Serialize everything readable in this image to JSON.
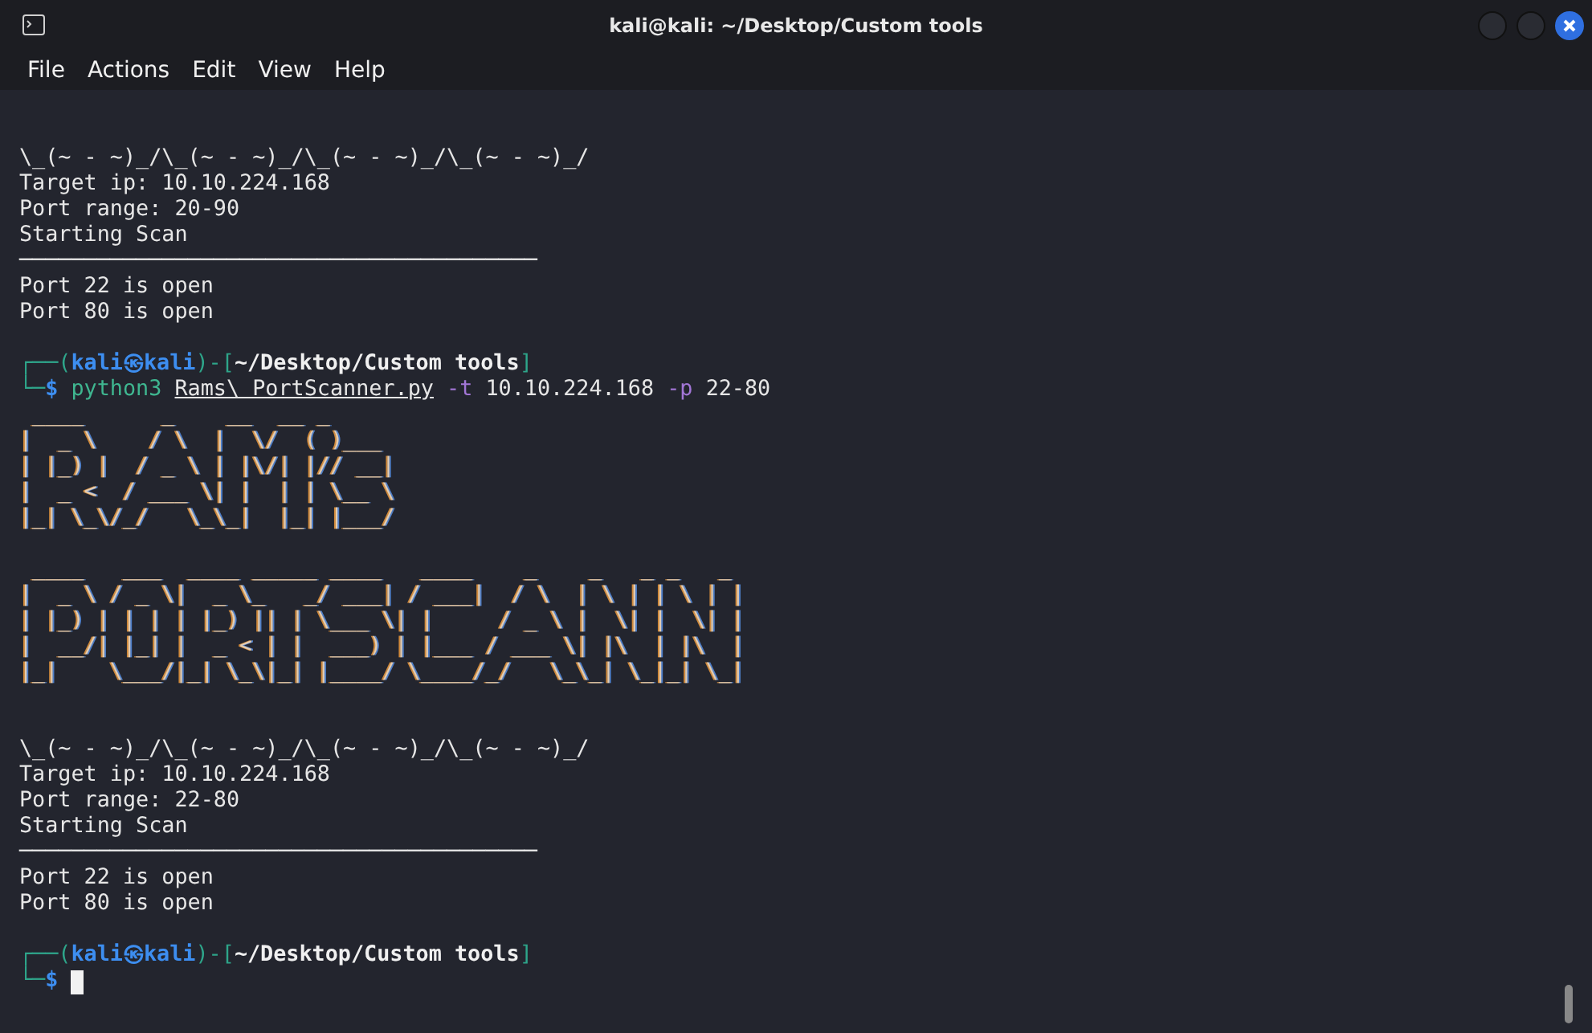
{
  "window": {
    "title": "kali@kali: ~/Desktop/Custom tools"
  },
  "menu": [
    "File",
    "Actions",
    "Edit",
    "View",
    "Help"
  ],
  "terminal": {
    "lines": [
      {
        "spans": [
          {
            "text": "\\_(~ - ~)_/\\_(~ - ~)_/\\_(~ - ~)_/\\_(~ - ~)_/",
            "kind": "plain"
          }
        ]
      },
      {
        "spans": [
          {
            "text": "Target ip: 10.10.224.168",
            "kind": "plain"
          }
        ]
      },
      {
        "spans": [
          {
            "text": "Port range: 20-90",
            "kind": "plain"
          }
        ]
      },
      {
        "spans": [
          {
            "text": "Starting Scan",
            "kind": "plain"
          }
        ]
      },
      {
        "spans": [
          {
            "text": "────────────────────────────────────────",
            "kind": "plain"
          }
        ]
      },
      {
        "spans": [
          {
            "text": "Port 22 is open",
            "kind": "plain"
          }
        ]
      },
      {
        "spans": [
          {
            "text": "Port 80 is open",
            "kind": "plain"
          }
        ]
      },
      {
        "kind": "blank"
      },
      {
        "spans": [
          {
            "text": "┌──(",
            "kind": "frame"
          },
          {
            "text": "kali㉿kali",
            "kind": "user"
          },
          {
            "text": ")-[",
            "kind": "frame"
          },
          {
            "text": "~/Desktop/Custom tools",
            "kind": "path"
          },
          {
            "text": "]",
            "kind": "frame"
          }
        ]
      },
      {
        "spans": [
          {
            "text": "└─",
            "kind": "frame"
          },
          {
            "text": "$ ",
            "kind": "dollar"
          },
          {
            "text": "python3 ",
            "kind": "program"
          },
          {
            "text": "Rams\\ PortScanner.py",
            "kind": "file"
          },
          {
            "text": " -t ",
            "kind": "flag"
          },
          {
            "text": "10.10.224.168 ",
            "kind": "plain"
          },
          {
            "text": "-p ",
            "kind": "flag"
          },
          {
            "text": "22-80",
            "kind": "plain"
          }
        ]
      },
      {
        "spans": [
          {
            "text": " ____      _    __  __ _     ",
            "kind": "art"
          }
        ]
      },
      {
        "spans": [
          {
            "text": "|  _ \\    / \\  |  \\/  ( )___ ",
            "kind": "art"
          }
        ]
      },
      {
        "spans": [
          {
            "text": "| |_) |  / _ \\ | |\\/| |// __|",
            "kind": "art"
          }
        ]
      },
      {
        "spans": [
          {
            "text": "|  _ <  / ___ \\| |  | | \\__ \\",
            "kind": "art"
          }
        ]
      },
      {
        "spans": [
          {
            "text": "|_| \\_\\/_/   \\_\\_|  |_| |___/",
            "kind": "art"
          }
        ]
      },
      {
        "kind": "blank"
      },
      {
        "spans": [
          {
            "text": " ____   ___  ____ _____ ____   ____    _    _   _ _   _ ",
            "kind": "art"
          }
        ]
      },
      {
        "spans": [
          {
            "text": "|  _ \\ / _ \\|  _ \\_   _/ ___| / ___|  / \\  | \\ | | \\ | |",
            "kind": "art"
          }
        ]
      },
      {
        "spans": [
          {
            "text": "| |_) | | | | |_) || | \\___ \\| |     / _ \\ |  \\| |  \\| |",
            "kind": "art"
          }
        ]
      },
      {
        "spans": [
          {
            "text": "|  __/| |_| |  _ < | |  ___) | |___ / ___ \\| |\\  | |\\  |",
            "kind": "art"
          }
        ]
      },
      {
        "spans": [
          {
            "text": "|_|    \\___/|_| \\_\\|_| |____/ \\____/_/   \\_\\_| \\_|_| \\_|",
            "kind": "art"
          }
        ]
      },
      {
        "kind": "blank"
      },
      {
        "kind": "blank"
      },
      {
        "spans": [
          {
            "text": "\\_(~ - ~)_/\\_(~ - ~)_/\\_(~ - ~)_/\\_(~ - ~)_/",
            "kind": "plain"
          }
        ]
      },
      {
        "spans": [
          {
            "text": "Target ip: 10.10.224.168",
            "kind": "plain"
          }
        ]
      },
      {
        "spans": [
          {
            "text": "Port range: 22-80",
            "kind": "plain"
          }
        ]
      },
      {
        "spans": [
          {
            "text": "Starting Scan",
            "kind": "plain"
          }
        ]
      },
      {
        "spans": [
          {
            "text": "────────────────────────────────────────",
            "kind": "plain"
          }
        ]
      },
      {
        "spans": [
          {
            "text": "Port 22 is open",
            "kind": "plain"
          }
        ]
      },
      {
        "spans": [
          {
            "text": "Port 80 is open",
            "kind": "plain"
          }
        ]
      },
      {
        "kind": "blank"
      },
      {
        "spans": [
          {
            "text": "┌──(",
            "kind": "frame"
          },
          {
            "text": "kali㉿kali",
            "kind": "user"
          },
          {
            "text": ")-[",
            "kind": "frame"
          },
          {
            "text": "~/Desktop/Custom tools",
            "kind": "path"
          },
          {
            "text": "]",
            "kind": "frame"
          }
        ]
      },
      {
        "cursor": true,
        "spans": [
          {
            "text": "└─",
            "kind": "frame"
          },
          {
            "text": "$ ",
            "kind": "dollar"
          }
        ]
      }
    ]
  }
}
